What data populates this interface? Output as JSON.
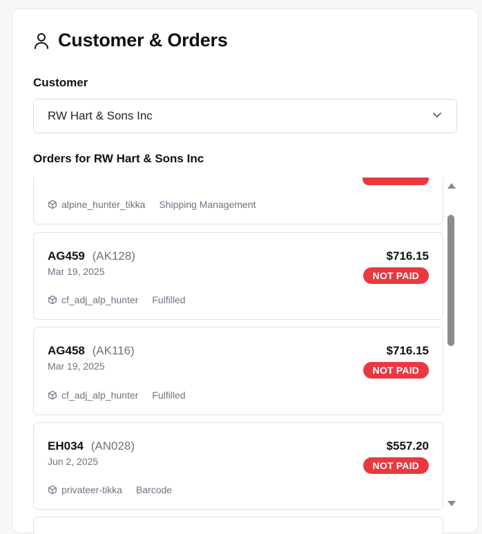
{
  "header": {
    "title": "Customer & Orders"
  },
  "customer_select": {
    "label": "Customer",
    "value": "RW Hart & Sons Inc"
  },
  "orders": {
    "heading": "Orders for RW Hart & Sons Inc",
    "items": [
      {
        "number": "",
        "ref": "",
        "date": "",
        "amount": "",
        "status_badge": "",
        "product": "alpine_hunter_tikka",
        "status": "Shipping Management"
      },
      {
        "number": "AG459",
        "ref": "(AK128)",
        "date": "Mar 19, 2025",
        "amount": "$716.15",
        "status_badge": "NOT PAID",
        "product": "cf_adj_alp_hunter",
        "status": "Fulfilled"
      },
      {
        "number": "AG458",
        "ref": "(AK116)",
        "date": "Mar 19, 2025",
        "amount": "$716.15",
        "status_badge": "NOT PAID",
        "product": "cf_adj_alp_hunter",
        "status": "Fulfilled"
      },
      {
        "number": "EH034",
        "ref": "(AN028)",
        "date": "Jun 2, 2025",
        "amount": "$557.20",
        "status_badge": "NOT PAID",
        "product": "privateer-tikka",
        "status": "Barcode"
      }
    ]
  },
  "colors": {
    "badge": "#e9383f",
    "muted_text": "#6b7280",
    "border": "#dfe2e6"
  },
  "icons": {
    "title": "user-icon",
    "select": "chevron-down-icon",
    "product": "package-icon"
  }
}
